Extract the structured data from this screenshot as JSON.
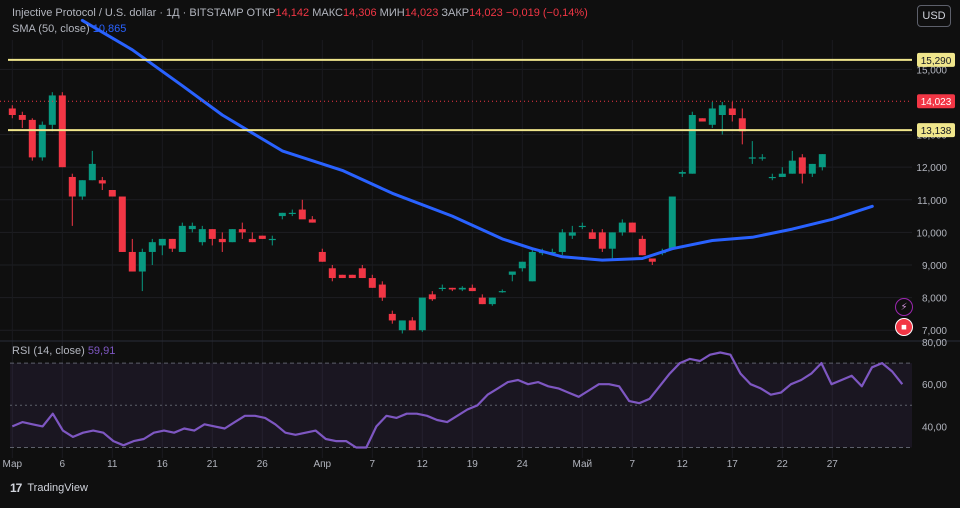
{
  "legend": {
    "title": "Injective Protocol / U.S. dollar · 1Д · BITSTAMP",
    "open_label": "ОТКР",
    "open_value": "14,142",
    "high_label": "МАКС",
    "high_value": "14,306",
    "low_label": "МИН",
    "low_value": "14,023",
    "close_label": "ЗАКР",
    "close_value": "14,023",
    "change": "−0,019 (−0,14%)",
    "sma_label": "SMA (50, close)",
    "sma_value": "10,865",
    "rsi_label": "RSI (14, close)",
    "rsi_value": "59,91"
  },
  "toolbar": {
    "currency": "USD"
  },
  "branding": {
    "logo_text": "TradingView",
    "logo_mark": "17"
  },
  "icons": [
    "flash-icon",
    "flag-icon",
    "tradingview-logo-icon"
  ],
  "colors": {
    "up": "#089981",
    "down": "#f23645",
    "sma": "#2962ff",
    "rsi": "#7e57c2",
    "level": "#f0e68c"
  },
  "chart_data": {
    "type": "candlestick",
    "symbol": "INJ/USD",
    "timeframe": "1Д",
    "x_labels": [
      {
        "i": 0,
        "label": "Мар"
      },
      {
        "i": 5,
        "label": "6"
      },
      {
        "i": 10,
        "label": "11"
      },
      {
        "i": 15,
        "label": "16"
      },
      {
        "i": 20,
        "label": "21"
      },
      {
        "i": 25,
        "label": "26"
      },
      {
        "i": 31,
        "label": "Апр"
      },
      {
        "i": 36,
        "label": "7"
      },
      {
        "i": 41,
        "label": "12"
      },
      {
        "i": 46,
        "label": "19"
      },
      {
        "i": 51,
        "label": "24"
      },
      {
        "i": 57,
        "label": "Май"
      },
      {
        "i": 62,
        "label": "7"
      },
      {
        "i": 67,
        "label": "12"
      },
      {
        "i": 72,
        "label": "17"
      },
      {
        "i": 77,
        "label": "22"
      },
      {
        "i": 82,
        "label": "27"
      }
    ],
    "y_ticks": [
      7000,
      8000,
      9000,
      10000,
      11000,
      12000,
      13000,
      15000
    ],
    "y_tick_labels": [
      "7,000",
      "8,000",
      "9,000",
      "10,000",
      "11,000",
      "12,000",
      "13,000",
      "15,000"
    ],
    "ylim": [
      6700,
      15900
    ],
    "candles": [
      {
        "o": 13.8,
        "h": 13.9,
        "l": 13.5,
        "c": 13.6
      },
      {
        "o": 13.6,
        "h": 13.7,
        "l": 13.2,
        "c": 13.45
      },
      {
        "o": 13.45,
        "h": 13.5,
        "l": 12.2,
        "c": 12.3
      },
      {
        "o": 12.3,
        "h": 13.4,
        "l": 12.2,
        "c": 13.3
      },
      {
        "o": 13.3,
        "h": 14.3,
        "l": 13.1,
        "c": 14.2
      },
      {
        "o": 14.2,
        "h": 14.3,
        "l": 12.0,
        "c": 12.0
      },
      {
        "o": 11.7,
        "h": 11.8,
        "l": 10.2,
        "c": 11.1
      },
      {
        "o": 11.1,
        "h": 11.6,
        "l": 11.0,
        "c": 11.6
      },
      {
        "o": 11.6,
        "h": 12.5,
        "l": 11.6,
        "c": 12.1
      },
      {
        "o": 11.6,
        "h": 11.7,
        "l": 11.3,
        "c": 11.5
      },
      {
        "o": 11.3,
        "h": 11.3,
        "l": 11.1,
        "c": 11.1
      },
      {
        "o": 11.1,
        "h": 11.1,
        "l": 9.4,
        "c": 9.4
      },
      {
        "o": 9.4,
        "h": 9.8,
        "l": 8.8,
        "c": 8.8
      },
      {
        "o": 8.8,
        "h": 9.5,
        "l": 8.2,
        "c": 9.4
      },
      {
        "o": 9.4,
        "h": 9.8,
        "l": 9.0,
        "c": 9.7
      },
      {
        "o": 9.6,
        "h": 9.8,
        "l": 9.3,
        "c": 9.8
      },
      {
        "o": 9.8,
        "h": 9.8,
        "l": 9.4,
        "c": 9.5
      },
      {
        "o": 9.4,
        "h": 10.3,
        "l": 9.4,
        "c": 10.2
      },
      {
        "o": 10.1,
        "h": 10.3,
        "l": 10.0,
        "c": 10.2
      },
      {
        "o": 9.7,
        "h": 10.2,
        "l": 9.6,
        "c": 10.1
      },
      {
        "o": 10.1,
        "h": 10.1,
        "l": 9.6,
        "c": 9.8
      },
      {
        "o": 9.8,
        "h": 10.0,
        "l": 9.4,
        "c": 9.7
      },
      {
        "o": 9.7,
        "h": 10.1,
        "l": 9.7,
        "c": 10.1
      },
      {
        "o": 10.1,
        "h": 10.3,
        "l": 9.8,
        "c": 10.0
      },
      {
        "o": 9.8,
        "h": 10.0,
        "l": 9.7,
        "c": 9.7
      },
      {
        "o": 9.9,
        "h": 9.9,
        "l": 9.8,
        "c": 9.8
      },
      {
        "o": 9.8,
        "h": 9.9,
        "l": 9.6,
        "c": 9.8
      },
      {
        "o": 10.5,
        "h": 10.6,
        "l": 10.4,
        "c": 10.6
      },
      {
        "o": 10.6,
        "h": 10.7,
        "l": 10.5,
        "c": 10.6
      },
      {
        "o": 10.7,
        "h": 11.0,
        "l": 10.6,
        "c": 10.4
      },
      {
        "o": 10.4,
        "h": 10.5,
        "l": 10.3,
        "c": 10.3
      },
      {
        "o": 9.4,
        "h": 9.5,
        "l": 9.1,
        "c": 9.1
      },
      {
        "o": 8.9,
        "h": 9.0,
        "l": 8.5,
        "c": 8.6
      },
      {
        "o": 8.7,
        "h": 8.7,
        "l": 8.6,
        "c": 8.6
      },
      {
        "o": 8.7,
        "h": 8.7,
        "l": 8.6,
        "c": 8.6
      },
      {
        "o": 8.9,
        "h": 9.0,
        "l": 8.6,
        "c": 8.6
      },
      {
        "o": 8.6,
        "h": 8.7,
        "l": 8.3,
        "c": 8.3
      },
      {
        "o": 8.4,
        "h": 8.5,
        "l": 7.9,
        "c": 8.0
      },
      {
        "o": 7.5,
        "h": 7.6,
        "l": 7.2,
        "c": 7.3
      },
      {
        "o": 7.0,
        "h": 7.3,
        "l": 6.9,
        "c": 7.3
      },
      {
        "o": 7.3,
        "h": 7.4,
        "l": 7.0,
        "c": 7.0
      },
      {
        "o": 7.0,
        "h": 8.0,
        "l": 6.95,
        "c": 8.0
      },
      {
        "o": 8.1,
        "h": 8.2,
        "l": 7.9,
        "c": 7.95
      },
      {
        "o": 8.3,
        "h": 8.4,
        "l": 8.2,
        "c": 8.3
      },
      {
        "o": 8.3,
        "h": 8.3,
        "l": 8.2,
        "c": 8.25
      },
      {
        "o": 8.25,
        "h": 8.35,
        "l": 8.2,
        "c": 8.3
      },
      {
        "o": 8.3,
        "h": 8.4,
        "l": 8.2,
        "c": 8.2
      },
      {
        "o": 8.0,
        "h": 8.1,
        "l": 7.8,
        "c": 7.8
      },
      {
        "o": 7.8,
        "h": 8.0,
        "l": 7.75,
        "c": 8.0
      },
      {
        "o": 8.2,
        "h": 8.25,
        "l": 8.15,
        "c": 8.2
      },
      {
        "o": 8.7,
        "h": 8.8,
        "l": 8.5,
        "c": 8.8
      },
      {
        "o": 8.9,
        "h": 9.1,
        "l": 8.8,
        "c": 9.1
      },
      {
        "o": 8.5,
        "h": 9.5,
        "l": 8.5,
        "c": 9.4
      },
      {
        "o": 9.4,
        "h": 9.5,
        "l": 9.3,
        "c": 9.4
      },
      {
        "o": 9.4,
        "h": 9.5,
        "l": 9.3,
        "c": 9.4
      },
      {
        "o": 9.4,
        "h": 10.1,
        "l": 9.3,
        "c": 10.0
      },
      {
        "o": 9.9,
        "h": 10.2,
        "l": 9.8,
        "c": 10.0
      },
      {
        "o": 10.2,
        "h": 10.3,
        "l": 10.1,
        "c": 10.2
      },
      {
        "o": 10.0,
        "h": 10.1,
        "l": 9.8,
        "c": 9.8
      },
      {
        "o": 10.0,
        "h": 10.1,
        "l": 9.4,
        "c": 9.5
      },
      {
        "o": 9.5,
        "h": 10.0,
        "l": 9.2,
        "c": 10.0
      },
      {
        "o": 10.0,
        "h": 10.4,
        "l": 9.9,
        "c": 10.3
      },
      {
        "o": 10.3,
        "h": 10.3,
        "l": 10.0,
        "c": 10.0
      },
      {
        "o": 9.8,
        "h": 9.9,
        "l": 9.3,
        "c": 9.3
      },
      {
        "o": 9.2,
        "h": 9.2,
        "l": 9.0,
        "c": 9.1
      },
      {
        "o": 9.4,
        "h": 9.5,
        "l": 9.3,
        "c": 9.4
      },
      {
        "o": 9.5,
        "h": 11.1,
        "l": 9.5,
        "c": 11.1
      },
      {
        "o": 11.8,
        "h": 11.9,
        "l": 11.7,
        "c": 11.85
      },
      {
        "o": 11.8,
        "h": 13.7,
        "l": 11.8,
        "c": 13.6
      },
      {
        "o": 13.5,
        "h": 13.5,
        "l": 13.4,
        "c": 13.4
      },
      {
        "o": 13.3,
        "h": 14.0,
        "l": 13.2,
        "c": 13.8
      },
      {
        "o": 13.6,
        "h": 14.0,
        "l": 13.0,
        "c": 13.9
      },
      {
        "o": 13.8,
        "h": 14.0,
        "l": 13.4,
        "c": 13.6
      },
      {
        "o": 13.5,
        "h": 13.8,
        "l": 12.7,
        "c": 13.1
      },
      {
        "o": 12.3,
        "h": 12.8,
        "l": 12.1,
        "c": 12.3
      },
      {
        "o": 12.3,
        "h": 12.4,
        "l": 12.2,
        "c": 12.3
      },
      {
        "o": 11.7,
        "h": 11.8,
        "l": 11.6,
        "c": 11.7
      },
      {
        "o": 11.7,
        "h": 12.0,
        "l": 11.7,
        "c": 11.8
      },
      {
        "o": 11.8,
        "h": 12.5,
        "l": 11.8,
        "c": 12.2
      },
      {
        "o": 12.3,
        "h": 12.4,
        "l": 11.5,
        "c": 11.8
      },
      {
        "o": 11.8,
        "h": 12.1,
        "l": 11.7,
        "c": 12.1
      },
      {
        "o": 12.0,
        "h": 12.4,
        "l": 11.9,
        "c": 12.4
      }
    ],
    "sma_points": [
      [
        7,
        16.5
      ],
      [
        12,
        15.6
      ],
      [
        17,
        14.5
      ],
      [
        21,
        13.6
      ],
      [
        27,
        12.5
      ],
      [
        33,
        11.9
      ],
      [
        38,
        11.2
      ],
      [
        44,
        10.5
      ],
      [
        49,
        9.8
      ],
      [
        52,
        9.5
      ],
      [
        55,
        9.25
      ],
      [
        59,
        9.15
      ],
      [
        63,
        9.2
      ],
      [
        66,
        9.5
      ],
      [
        70,
        9.75
      ],
      [
        74,
        9.85
      ],
      [
        78,
        10.1
      ],
      [
        82,
        10.4
      ],
      [
        86,
        10.8
      ]
    ],
    "sma_name": "SMA (50, close)",
    "rsi": {
      "label": "RSI (14, close)",
      "ylim": [
        25,
        80
      ],
      "y_ticks": [
        40,
        60,
        80
      ],
      "y_tick_labels": [
        "40,00",
        "60,00",
        "80,00"
      ],
      "band": [
        30,
        70
      ],
      "mid": 50,
      "values": [
        40,
        42,
        41,
        40,
        46,
        38,
        35,
        37,
        38,
        37,
        33,
        31,
        33,
        34,
        37,
        38,
        37,
        39,
        38,
        41,
        40,
        39,
        42,
        45,
        45,
        44,
        41,
        37,
        36,
        37,
        38,
        34,
        33,
        33,
        30,
        30,
        40,
        45,
        44,
        46,
        46,
        45,
        43,
        42,
        45,
        48,
        50,
        55,
        58,
        61,
        62,
        60,
        61,
        59,
        58,
        56,
        54,
        57,
        60,
        60,
        59,
        52,
        51,
        53,
        59,
        65,
        70,
        72,
        71,
        74,
        75,
        74,
        65,
        60,
        58,
        55,
        56,
        60,
        62,
        65,
        70,
        60,
        62,
        64,
        59,
        68,
        70,
        66,
        60
      ]
    }
  },
  "price_scale": {
    "levels": [
      {
        "value": 15290,
        "label": "15,290"
      },
      {
        "value": 13138,
        "label": "13,138"
      }
    ],
    "last_price": {
      "value": 14023,
      "label": "14,023"
    }
  }
}
